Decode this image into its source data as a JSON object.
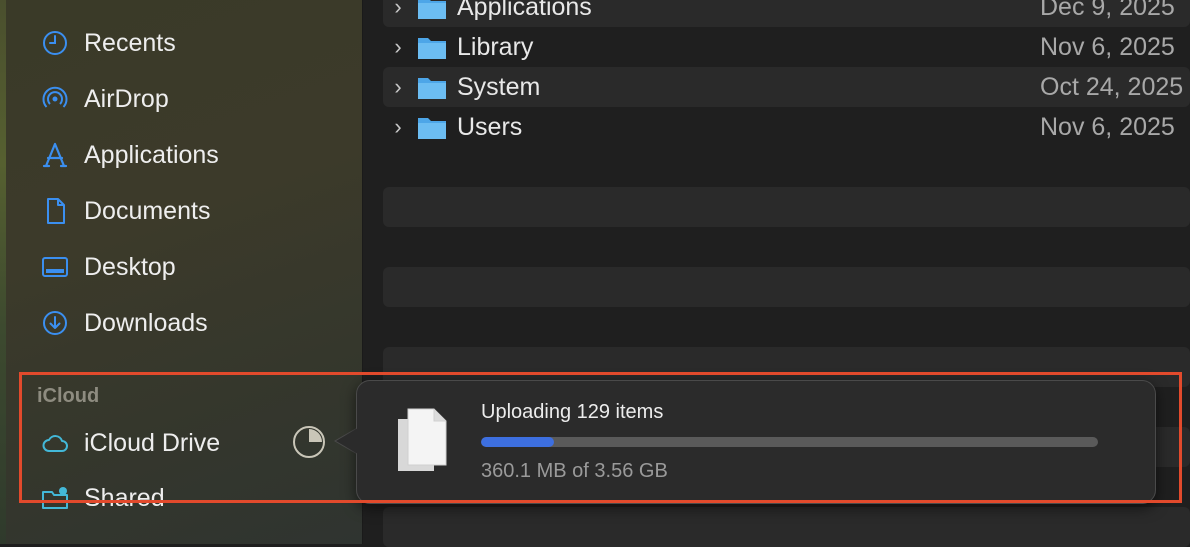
{
  "sidebar": {
    "items": [
      {
        "label": "Recents",
        "icon": "clock-icon"
      },
      {
        "label": "AirDrop",
        "icon": "airdrop-icon"
      },
      {
        "label": "Applications",
        "icon": "applications-icon"
      },
      {
        "label": "Documents",
        "icon": "document-icon"
      },
      {
        "label": "Desktop",
        "icon": "desktop-icon"
      },
      {
        "label": "Downloads",
        "icon": "download-icon"
      }
    ],
    "icloud_header": "iCloud",
    "icloud_items": [
      {
        "label": "iCloud Drive",
        "icon": "cloud-icon"
      },
      {
        "label": "Shared",
        "icon": "shared-folder-icon"
      }
    ],
    "accent_color": "#3b8ff0",
    "icloud_accent_color": "#43b8d8"
  },
  "files": [
    {
      "name": "Applications",
      "date": "Dec 9, 2025"
    },
    {
      "name": "Library",
      "date": "Nov 6, 2025"
    },
    {
      "name": "System",
      "date": "Oct 24, 2025"
    },
    {
      "name": "Users",
      "date": "Nov 6, 2025"
    }
  ],
  "upload_popover": {
    "title": "Uploading 129 items",
    "detail": "360.1 MB of 3.56 GB",
    "progress_fraction": 0.118,
    "progress_color": "#3d6fe0"
  },
  "highlight_color": "#e24a2c"
}
